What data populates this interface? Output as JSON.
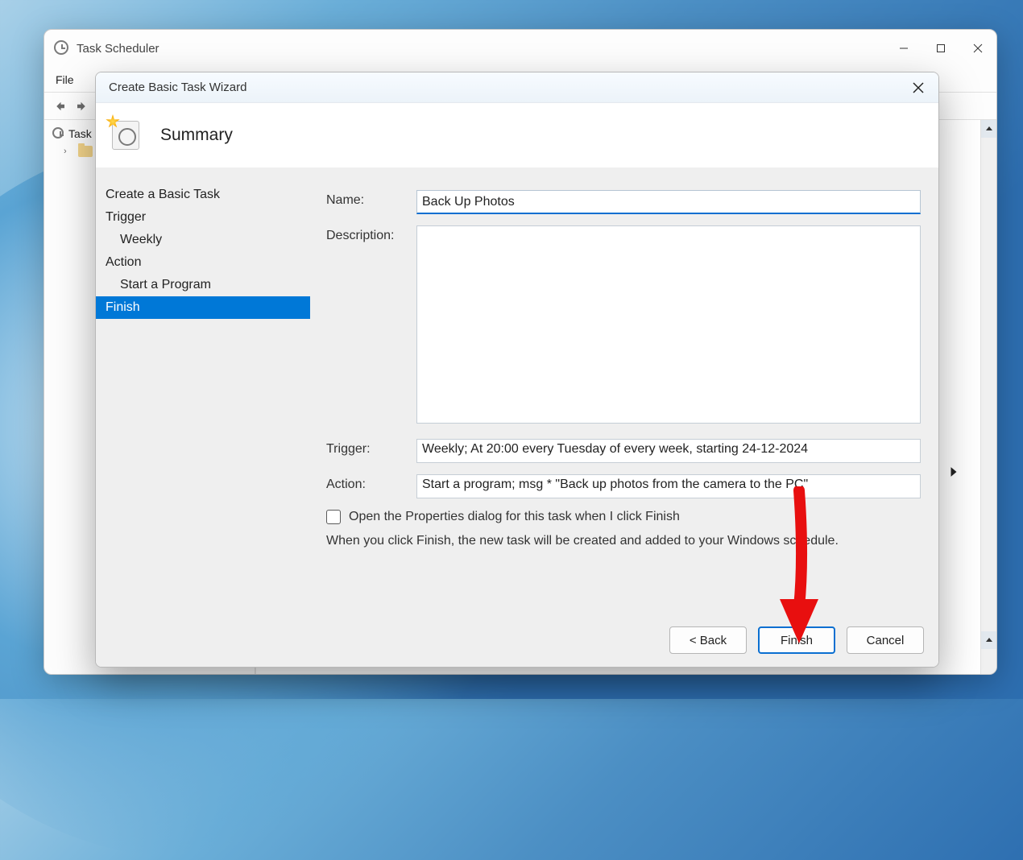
{
  "parent_window": {
    "title": "Task Scheduler",
    "menubar": {
      "file": "File"
    },
    "tree": {
      "root": "Task",
      "lib_icon": "folder-icon"
    }
  },
  "wizard": {
    "title": "Create Basic Task Wizard",
    "header": "Summary",
    "steps": {
      "create": "Create a Basic Task",
      "trigger": "Trigger",
      "trigger_sub": "Weekly",
      "action": "Action",
      "action_sub": "Start a Program",
      "finish": "Finish"
    },
    "labels": {
      "name": "Name:",
      "description": "Description:",
      "trigger": "Trigger:",
      "action": "Action:"
    },
    "values": {
      "name": "Back Up Photos",
      "description": "",
      "trigger": "Weekly; At 20:00 every Tuesday of every week, starting 24-12-2024",
      "action": "Start a program; msg * \"Back up photos from the camera to the PC\""
    },
    "checkbox_label": "Open the Properties dialog for this task when I click Finish",
    "checkbox_checked": false,
    "hint": "When you click Finish, the new task will be created and added to your Windows schedule.",
    "buttons": {
      "back": "< Back",
      "finish": "Finish",
      "cancel": "Cancel"
    }
  }
}
